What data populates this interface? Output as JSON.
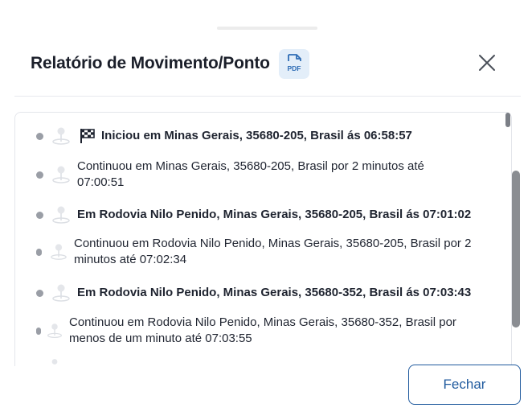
{
  "dialog": {
    "title": "Relatório de Movimento/Ponto",
    "pdf_label": "PDF",
    "close_button_label": "Fechar"
  },
  "items": [
    {
      "text": "Iniciou em Minas Gerais, 35680-205, Brasil ás 06:58:57",
      "bold": true,
      "icon": "flag-icon"
    },
    {
      "text": "Continuou em Minas Gerais, 35680-205, Brasil por 2 minutos até 07:00:51",
      "bold": false
    },
    {
      "text": "Em Rodovia Nilo Penido, Minas Gerais, 35680-205, Brasil ás 07:01:02",
      "bold": true
    },
    {
      "text": "Continuou em Rodovia Nilo Penido, Minas Gerais, 35680-205, Brasil por 2 minutos até 07:02:34",
      "bold": false
    },
    {
      "text": "Em Rodovia Nilo Penido, Minas Gerais, 35680-352, Brasil ás 07:03:43",
      "bold": true
    },
    {
      "text": "Continuou em Rodovia Nilo Penido, Minas Gerais, 35680-352, Brasil por menos de um minuto até 07:03:55",
      "bold": false
    }
  ],
  "colors": {
    "accent": "#1f5a9e",
    "pdf_bg": "#e3eef9",
    "dot": "#9a9ea6"
  }
}
